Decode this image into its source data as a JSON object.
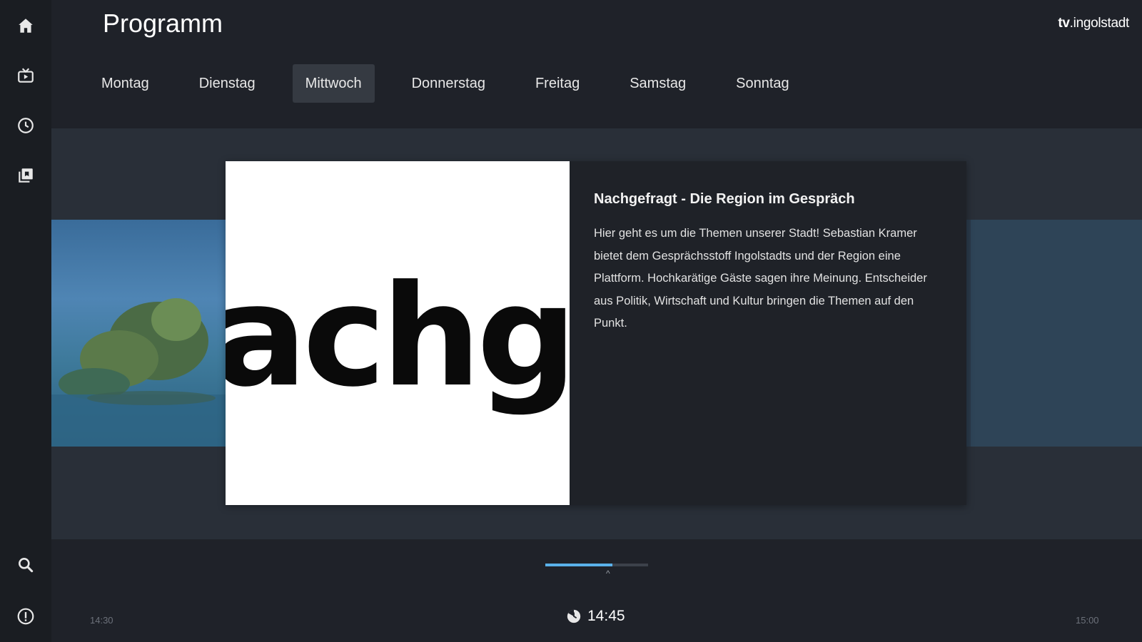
{
  "sidebar": {
    "items": [
      {
        "icon": "home-icon"
      },
      {
        "icon": "tv-icon"
      },
      {
        "icon": "clock-icon"
      },
      {
        "icon": "library-icon"
      }
    ],
    "bottom": [
      {
        "icon": "search-icon"
      },
      {
        "icon": "info-icon"
      }
    ]
  },
  "header": {
    "title": "Programm",
    "brand_bold": "tv",
    "brand_rest": ".ingolstadt"
  },
  "tabs": [
    {
      "label": "Montag",
      "active": false
    },
    {
      "label": "Dienstag",
      "active": false
    },
    {
      "label": "Mittwoch",
      "active": true
    },
    {
      "label": "Donnerstag",
      "active": false
    },
    {
      "label": "Freitag",
      "active": false
    },
    {
      "label": "Samstag",
      "active": false
    },
    {
      "label": "Sonntag",
      "active": false
    }
  ],
  "card": {
    "thumbnail_text": "achge",
    "title": "Nachgefragt - Die Region im Gespräch",
    "description": "Hier geht es um die Themen unserer Stadt! Sebastian Kramer bietet dem Gesprächsstoff Ingolstadts und der Region eine Plattform. Hochkarätige Gäste sagen ihre Meinung. Entscheider aus Politik, Wirtschaft und Kultur bringen die Themen auf den Punkt."
  },
  "timeline": {
    "start": "14:30",
    "end": "15:00",
    "current": "14:45",
    "progress": 0.65
  },
  "colors": {
    "background": "#1f2229",
    "accent": "#5ab1ea",
    "active_tab": "#353a42"
  }
}
